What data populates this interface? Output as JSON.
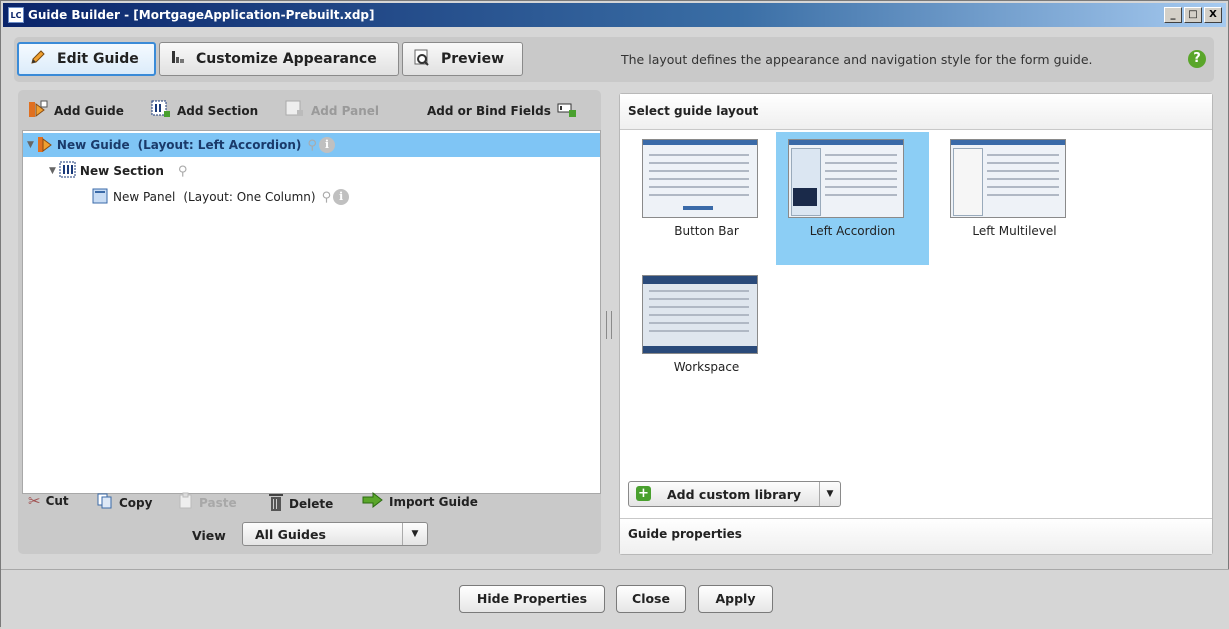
{
  "window": {
    "title": "Guide Builder - [MortgageApplication-Prebuilt.xdp]",
    "app_badge": "LC",
    "controls": [
      "_",
      "□",
      "X"
    ]
  },
  "topbar": {
    "tabs": [
      {
        "label": "Edit Guide",
        "icon": "pencil-icon",
        "active": true
      },
      {
        "label": "Customize Appearance",
        "icon": "layout-icon",
        "active": false
      },
      {
        "label": "Preview",
        "icon": "preview-icon",
        "active": false
      }
    ],
    "info_text": "The layout defines the appearance and navigation style for the form guide.",
    "help_label": "?"
  },
  "left_toolbar": {
    "add_guide": "Add Guide",
    "add_section": "Add Section",
    "add_panel": "Add Panel",
    "add_or_bind_fields": "Add or Bind Fields"
  },
  "tree": {
    "guide": {
      "name": "New Guide",
      "layout": "(Layout: Left Accordion)"
    },
    "section": {
      "name": "New Section"
    },
    "panel": {
      "name": "New Panel",
      "layout": "(Layout: One Column)"
    }
  },
  "bottom_toolbar": {
    "cut": "Cut",
    "copy": "Copy",
    "paste": "Paste",
    "delete": "Delete",
    "import_guide": "Import Guide"
  },
  "view": {
    "label": "View",
    "selected": "All Guides"
  },
  "right_panel": {
    "header": "Select guide layout",
    "layouts": [
      {
        "label": "Button Bar",
        "selected": false
      },
      {
        "label": "Left Accordion",
        "selected": true
      },
      {
        "label": "Left Multilevel",
        "selected": false
      },
      {
        "label": "Workspace",
        "selected": false
      }
    ],
    "add_custom_library": "Add custom library",
    "footer": "Guide properties"
  },
  "dialog_buttons": {
    "hide_properties": "Hide Properties",
    "close": "Close",
    "apply": "Apply"
  },
  "colors": {
    "selection": "#7fc5f5",
    "accent": "#3a8bd8",
    "title_start": "#0a246a"
  }
}
